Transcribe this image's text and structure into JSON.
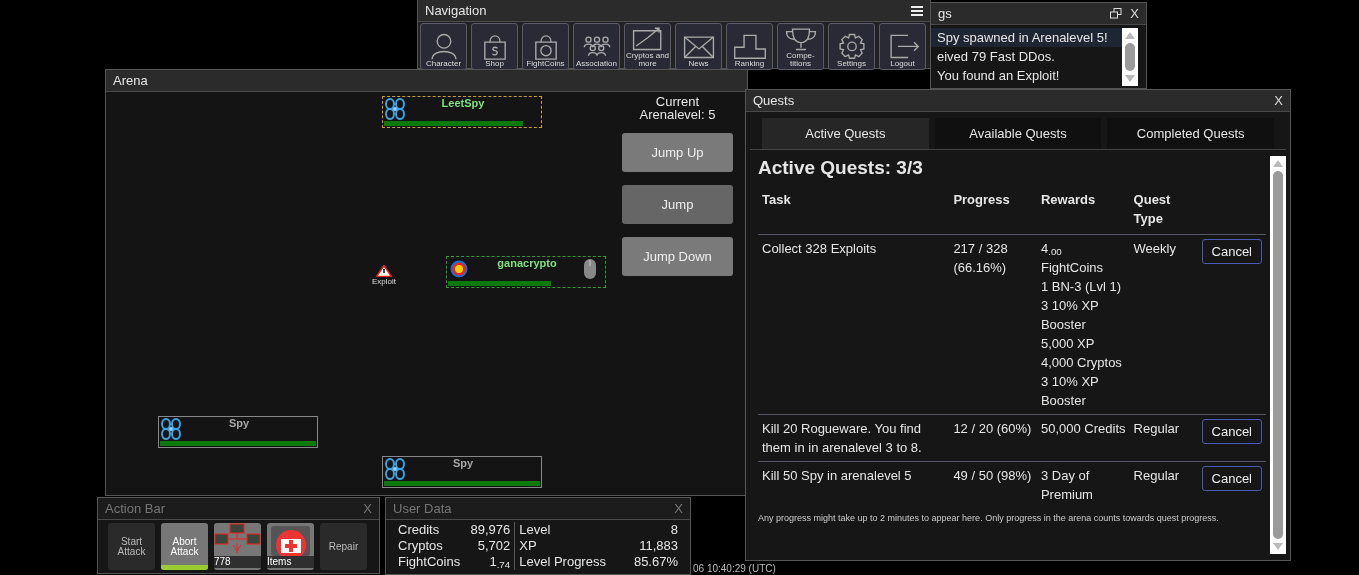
{
  "logs": {
    "title": "gs",
    "close": "X",
    "lines": [
      {
        "text": "Spy spawned in Arenalevel 5!",
        "highlighted": true
      },
      {
        "text": "eived 79 Fast DDos.",
        "highlighted": false
      },
      {
        "text": "You found an Exploit!",
        "highlighted": false
      }
    ]
  },
  "navigation": {
    "title": "Navigation",
    "items": [
      {
        "label": "Character",
        "kind": "person"
      },
      {
        "label": "Shop",
        "kind": "bag"
      },
      {
        "label": "FightCoins",
        "kind": "coinbag"
      },
      {
        "label": "Association",
        "kind": "crowd"
      },
      {
        "label": "Cryptos and more",
        "kind": "chart"
      },
      {
        "label": "News",
        "kind": "envelope"
      },
      {
        "label": "Ranking",
        "kind": "podium"
      },
      {
        "label": "Compe-titions",
        "kind": "trophy"
      },
      {
        "label": "Settings",
        "kind": "gear"
      },
      {
        "label": "Logout",
        "kind": "exit"
      }
    ]
  },
  "action_bar": {
    "title": "Action Bar",
    "close": "X",
    "buttons": [
      {
        "kind": "text",
        "label": "Start Attack",
        "active": false
      },
      {
        "kind": "text",
        "label": "Abort Attack",
        "active": true,
        "level": 1
      },
      {
        "kind": "software",
        "label": "778"
      },
      {
        "kind": "items",
        "label": "Items"
      },
      {
        "kind": "text",
        "label": "Repair",
        "active": false
      }
    ]
  },
  "user_data": {
    "title": "User Data",
    "close": "X",
    "left": [
      {
        "label": "Credits",
        "value": "89,976"
      },
      {
        "label": "Cryptos",
        "value": "5,702"
      },
      {
        "label": "FightCoins",
        "value": "1$_{.74}$"
      }
    ],
    "right": [
      {
        "label": "Level",
        "value": "8"
      },
      {
        "label": "XP",
        "value": "11,883"
      },
      {
        "label": "Level Progress",
        "value": "85.67%"
      }
    ]
  },
  "servertime": "06 10:40:29 (UTC)",
  "arena": {
    "title": "Arena",
    "level_label": "Current Arenalevel: 5",
    "buttons": [
      {
        "label": "Jump Up",
        "disabled": false
      },
      {
        "label": "Jump",
        "disabled": true
      },
      {
        "label": "Jump Down",
        "disabled": false
      }
    ],
    "entities": [
      {
        "name": "LeetSpy",
        "kind": "npc",
        "targeted": true,
        "level": 0.89,
        "color": "#7ee07e"
      },
      {
        "name": "ganacrypto",
        "kind": "player",
        "targeted": false,
        "level": 0.66,
        "color": "#7ee07e"
      },
      {
        "name": "Spy",
        "kind": "npc",
        "targeted": false,
        "level": 1,
        "color": "#a8a8a8"
      },
      {
        "name": "Spy",
        "kind": "npc",
        "targeted": false,
        "level": 1,
        "color": "#a8a8a8"
      }
    ],
    "exploit": {
      "label": "Exploit"
    }
  },
  "quests": {
    "title": "Quests",
    "close": "X",
    "tabs": [
      {
        "label": "Active Quests",
        "selected": true
      },
      {
        "label": "Available Quests",
        "selected": false
      },
      {
        "label": "Completed Quests",
        "selected": false
      }
    ],
    "heading": "Active Quests: 3/3",
    "columns": [
      "Task",
      "Progress",
      "Rewards",
      "Quest Type"
    ],
    "rows": [
      {
        "task": "Collect 328 Exploits",
        "progress": "217 / 328 (66.16%)",
        "rewards": [
          "4$_{.00}$ FightCoins",
          "1 BN-3 (Lvl 1)",
          "3 10% XP Booster",
          "5,000 XP",
          "4,000 Cryptos",
          "3 10% XP Booster"
        ],
        "type": "Weekly",
        "action": "Cancel"
      },
      {
        "task": "Kill 20 Rogueware. You find them in in arenalevel 3 to 8.",
        "progress": "12 / 20 (60%)",
        "rewards": [
          "50,000 Credits"
        ],
        "type": "Regular",
        "action": "Cancel"
      },
      {
        "task": "Kill 50 Spy in arenalevel 5",
        "progress": "49 / 50 (98%)",
        "rewards": [
          "3 Day of Premium"
        ],
        "type": "Regular",
        "action": "Cancel"
      }
    ],
    "note": "Any progress might take up to 2 minutes to appear here. Only progress in the arena counts towards quest progress."
  }
}
